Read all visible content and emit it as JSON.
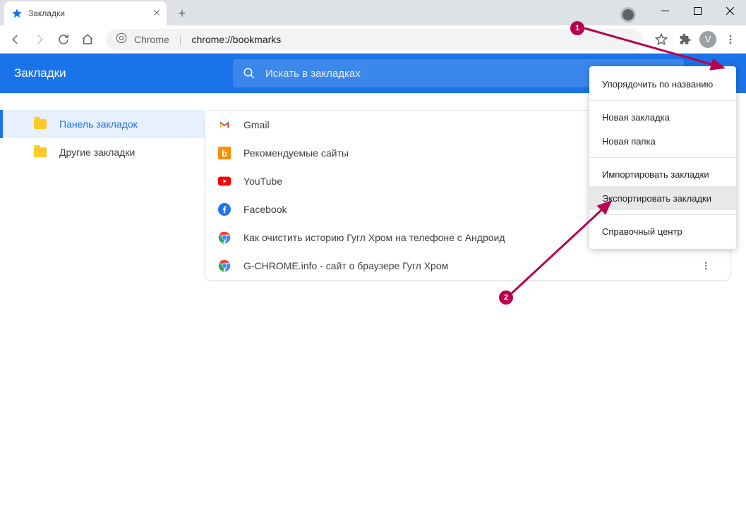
{
  "tab": {
    "title": "Закладки"
  },
  "omnibox": {
    "scheme_label": "Chrome",
    "url": "chrome://bookmarks"
  },
  "avatar": {
    "letter": "V"
  },
  "header": {
    "title": "Закладки",
    "search_placeholder": "Искать в закладках"
  },
  "sidebar": {
    "items": [
      {
        "label": "Панель закладок",
        "active": true
      },
      {
        "label": "Другие закладки",
        "active": false
      }
    ]
  },
  "bookmarks": [
    {
      "title": "Gmail",
      "icon": "gmail"
    },
    {
      "title": "Рекомендуемые сайты",
      "icon": "bing"
    },
    {
      "title": "YouTube",
      "icon": "youtube"
    },
    {
      "title": "Facebook",
      "icon": "facebook"
    },
    {
      "title": "Как очистить историю Гугл Хром на телефоне с Андроид",
      "icon": "chrome"
    },
    {
      "title": "G-CHROME.info - сайт о браузере Гугл Хром",
      "icon": "chrome"
    }
  ],
  "menu": {
    "items": [
      {
        "label": "Упорядочить по названию",
        "highlight": false
      },
      {
        "type": "sep"
      },
      {
        "label": "Новая закладка",
        "highlight": false
      },
      {
        "label": "Новая папка",
        "highlight": false
      },
      {
        "type": "sep"
      },
      {
        "label": "Импортировать закладки",
        "highlight": false
      },
      {
        "label": "Экспортировать закладки",
        "highlight": true
      },
      {
        "type": "sep"
      },
      {
        "label": "Справочный центр",
        "highlight": false
      }
    ]
  },
  "annotations": {
    "marker1": "1",
    "marker2": "2"
  }
}
